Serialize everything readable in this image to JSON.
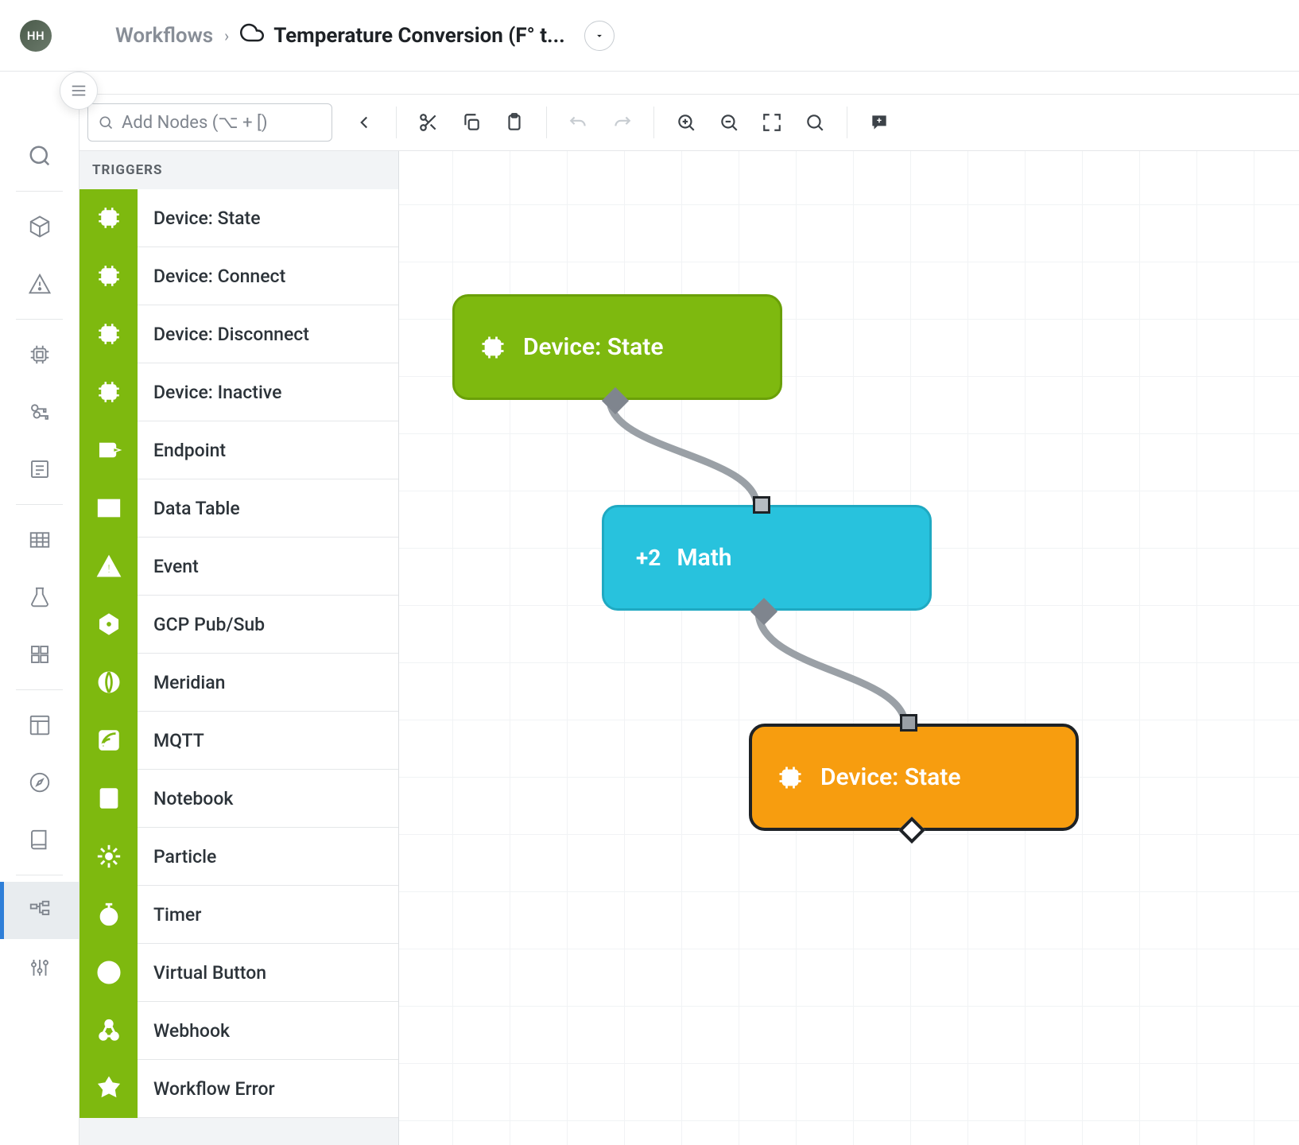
{
  "breadcrumb": {
    "root": "Workflows",
    "current": "Temperature Conversion (F° t..."
  },
  "avatar": {
    "label": "HH"
  },
  "search": {
    "placeholder": "Add Nodes (⌥ + [)"
  },
  "panel": {
    "header": "TRIGGERS",
    "items": [
      {
        "label": "Device: State",
        "icon": "chip"
      },
      {
        "label": "Device: Connect",
        "icon": "chip"
      },
      {
        "label": "Device: Disconnect",
        "icon": "chip"
      },
      {
        "label": "Device: Inactive",
        "icon": "chip"
      },
      {
        "label": "Endpoint",
        "icon": "endpoint"
      },
      {
        "label": "Data Table",
        "icon": "table"
      },
      {
        "label": "Event",
        "icon": "event"
      },
      {
        "label": "GCP Pub/Sub",
        "icon": "hex"
      },
      {
        "label": "Meridian",
        "icon": "meridian"
      },
      {
        "label": "MQTT",
        "icon": "mqtt"
      },
      {
        "label": "Notebook",
        "icon": "notebook"
      },
      {
        "label": "Particle",
        "icon": "particle"
      },
      {
        "label": "Timer",
        "icon": "timer"
      },
      {
        "label": "Virtual Button",
        "icon": "vbutton"
      },
      {
        "label": "Webhook",
        "icon": "webhook"
      },
      {
        "label": "Workflow Error",
        "icon": "werror"
      }
    ]
  },
  "canvas_nodes": {
    "n1": {
      "label": "Device: State",
      "color": "green"
    },
    "n2": {
      "prefix": "+2",
      "label": "Math",
      "color": "cyan"
    },
    "n3": {
      "label": "Device: State",
      "color": "orange"
    }
  },
  "colors": {
    "trigger_green": "#7eb90f",
    "logic_cyan": "#28c2dd",
    "output_orange": "#f79d0f"
  }
}
